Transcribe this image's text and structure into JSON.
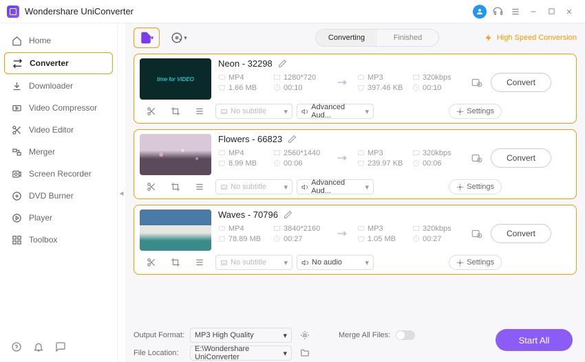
{
  "app": {
    "title": "Wondershare UniConverter"
  },
  "sidebar": {
    "items": [
      {
        "label": "Home"
      },
      {
        "label": "Converter"
      },
      {
        "label": "Downloader"
      },
      {
        "label": "Video Compressor"
      },
      {
        "label": "Video Editor"
      },
      {
        "label": "Merger"
      },
      {
        "label": "Screen Recorder"
      },
      {
        "label": "DVD Burner"
      },
      {
        "label": "Player"
      },
      {
        "label": "Toolbox"
      }
    ]
  },
  "toolbar": {
    "tab_converting": "Converting",
    "tab_finished": "Finished",
    "high_speed": "High Speed Conversion"
  },
  "files": [
    {
      "title": "Neon - 32298",
      "src_fmt": "MP4",
      "src_res": "1280*720",
      "src_size": "1.66 MB",
      "src_dur": "00:10",
      "dst_fmt": "MP3",
      "dst_bit": "320kbps",
      "dst_size": "397.46 KB",
      "dst_dur": "00:10",
      "subtitle": "No subtitle",
      "audio": "Advanced Aud...",
      "settings": "Settings",
      "convert": "Convert"
    },
    {
      "title": "Flowers - 66823",
      "src_fmt": "MP4",
      "src_res": "2560*1440",
      "src_size": "8.99 MB",
      "src_dur": "00:06",
      "dst_fmt": "MP3",
      "dst_bit": "320kbps",
      "dst_size": "239.97 KB",
      "dst_dur": "00:06",
      "subtitle": "No subtitle",
      "audio": "Advanced Aud...",
      "settings": "Settings",
      "convert": "Convert"
    },
    {
      "title": "Waves - 70796",
      "src_fmt": "MP4",
      "src_res": "3840*2160",
      "src_size": "78.89 MB",
      "src_dur": "00:27",
      "dst_fmt": "MP3",
      "dst_bit": "320kbps",
      "dst_size": "1.05 MB",
      "dst_dur": "00:27",
      "subtitle": "No subtitle",
      "audio": "No audio",
      "settings": "Settings",
      "convert": "Convert"
    }
  ],
  "footer": {
    "output_format_label": "Output Format:",
    "output_format_value": "MP3 High Quality",
    "file_location_label": "File Location:",
    "file_location_value": "E:\\Wondershare UniConverter",
    "merge_label": "Merge All Files:",
    "start_all": "Start All"
  }
}
